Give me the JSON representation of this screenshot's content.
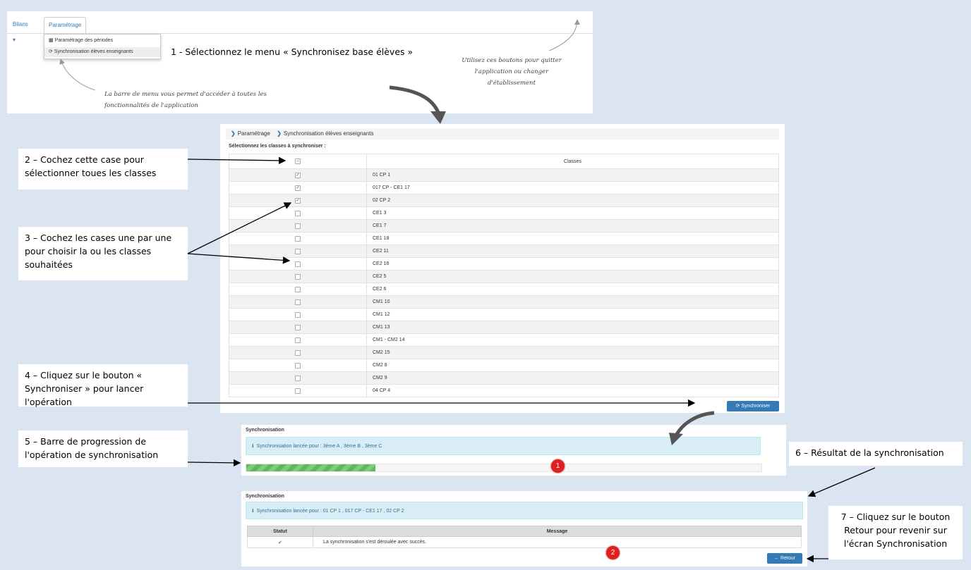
{
  "app_nav": {
    "bilans": "Bilans",
    "parametrage": "Paramétrage",
    "menu_items": [
      "Paramétrage des périodes",
      "Synchronisation élèves enseignants"
    ]
  },
  "notes": {
    "menu_bar": "La barre de menu vous permet d'accéder à toutes les fonctionnalités de l'application",
    "buttons": "Utilisez ces boutons pour quitter l'application ou changer d'établissement"
  },
  "callouts": {
    "step1": "1 - Sélectionnez le menu « Synchronisez base élèves »",
    "step2": "2 – Cochez cette case pour sélectionner toues les classes",
    "step3": "3 – Cochez  les cases une par une pour choisir la ou les classes souhaitées",
    "step4": "4 – Cliquez sur le bouton « Synchroniser » pour lancer l'opération",
    "step5": "5 – Barre de progression de l'opération de synchronisation",
    "step6": "6 – Résultat de la synchronisation",
    "step7": "7 – Cliquez sur le bouton Retour pour revenir sur l'écran Synchronisation"
  },
  "breadcrumb": [
    "Paramétrage",
    "Synchronisation élèves enseignants"
  ],
  "table": {
    "select_label": "Sélectionnez les classes à synchroniser :",
    "header": "Classes",
    "rows": [
      {
        "name": "01 CP 1",
        "checked": true
      },
      {
        "name": "017 CP - CE1 17",
        "checked": true
      },
      {
        "name": "02 CP 2",
        "checked": true
      },
      {
        "name": "CE1 3",
        "checked": false
      },
      {
        "name": "CE1 7",
        "checked": false
      },
      {
        "name": "CE1 18",
        "checked": false
      },
      {
        "name": "CE2 11",
        "checked": false
      },
      {
        "name": "CE2 16",
        "checked": false
      },
      {
        "name": "CE2 5",
        "checked": false
      },
      {
        "name": "CE2 6",
        "checked": false
      },
      {
        "name": "CM1 10",
        "checked": false
      },
      {
        "name": "CM1 12",
        "checked": false
      },
      {
        "name": "CM1 13",
        "checked": false
      },
      {
        "name": "CM1 - CM2 14",
        "checked": false
      },
      {
        "name": "CM2 15",
        "checked": false
      },
      {
        "name": "CM2 8",
        "checked": false
      },
      {
        "name": "CM2 9",
        "checked": false
      },
      {
        "name": "04 CP 4",
        "checked": false
      }
    ]
  },
  "sync_button": "Synchroniser",
  "sync1": {
    "title": "Synchronisation",
    "alert": "Synchronisation lancée pour : 3ème A , 3ème B , 3ème C",
    "progress": 0.25,
    "badge": "1"
  },
  "sync2": {
    "title": "Synchronisation",
    "alert": "Synchronisation lancée pour : 01 CP 1 , 017 CP - CE1 17 , 02 CP 2",
    "col_status": "Statut",
    "col_message": "Message",
    "status_icon": "✔",
    "message": "La synchronisation s'est déroulée avec succès.",
    "badge": "2",
    "back_button": "Retour"
  },
  "colors": {
    "background": "#dbe5f1",
    "primary": "#337ab7",
    "success": "#5cb85c",
    "badge": "#e02020"
  }
}
